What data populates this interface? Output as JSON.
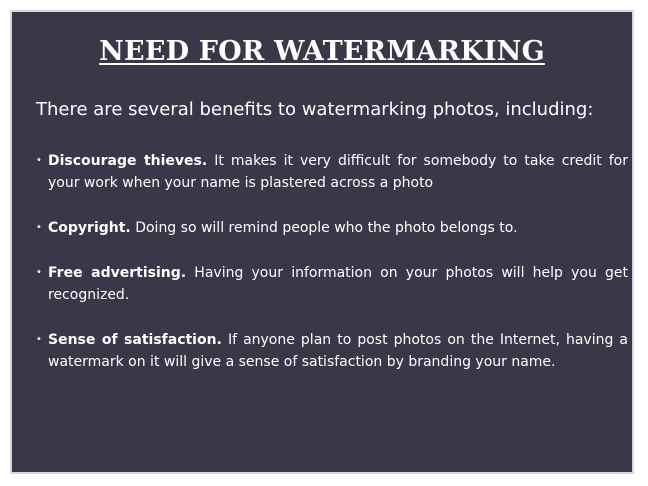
{
  "slide": {
    "title": "NEED FOR WATERMARKING",
    "intro": "There are several benefits to watermarking photos, including:",
    "bullets": [
      {
        "lead": "Discourage thieves.",
        "text": "It makes it very difficult for somebody to take credit for your work when your name is plastered across a photo"
      },
      {
        "lead": "Copyright.",
        "text": "Doing so will remind people who the photo belongs to."
      },
      {
        "lead": "Free advertising.",
        "text": "Having your information on your photos will help you get recognized."
      },
      {
        "lead": "Sense of satisfaction.",
        "text": "If anyone plan to post photos on the Internet, having a watermark on it will give a sense of satisfaction by branding your name."
      }
    ]
  },
  "colors": {
    "panel_background": "#3a3848",
    "panel_border": "#d6d6dc",
    "text": "#ffffff"
  }
}
